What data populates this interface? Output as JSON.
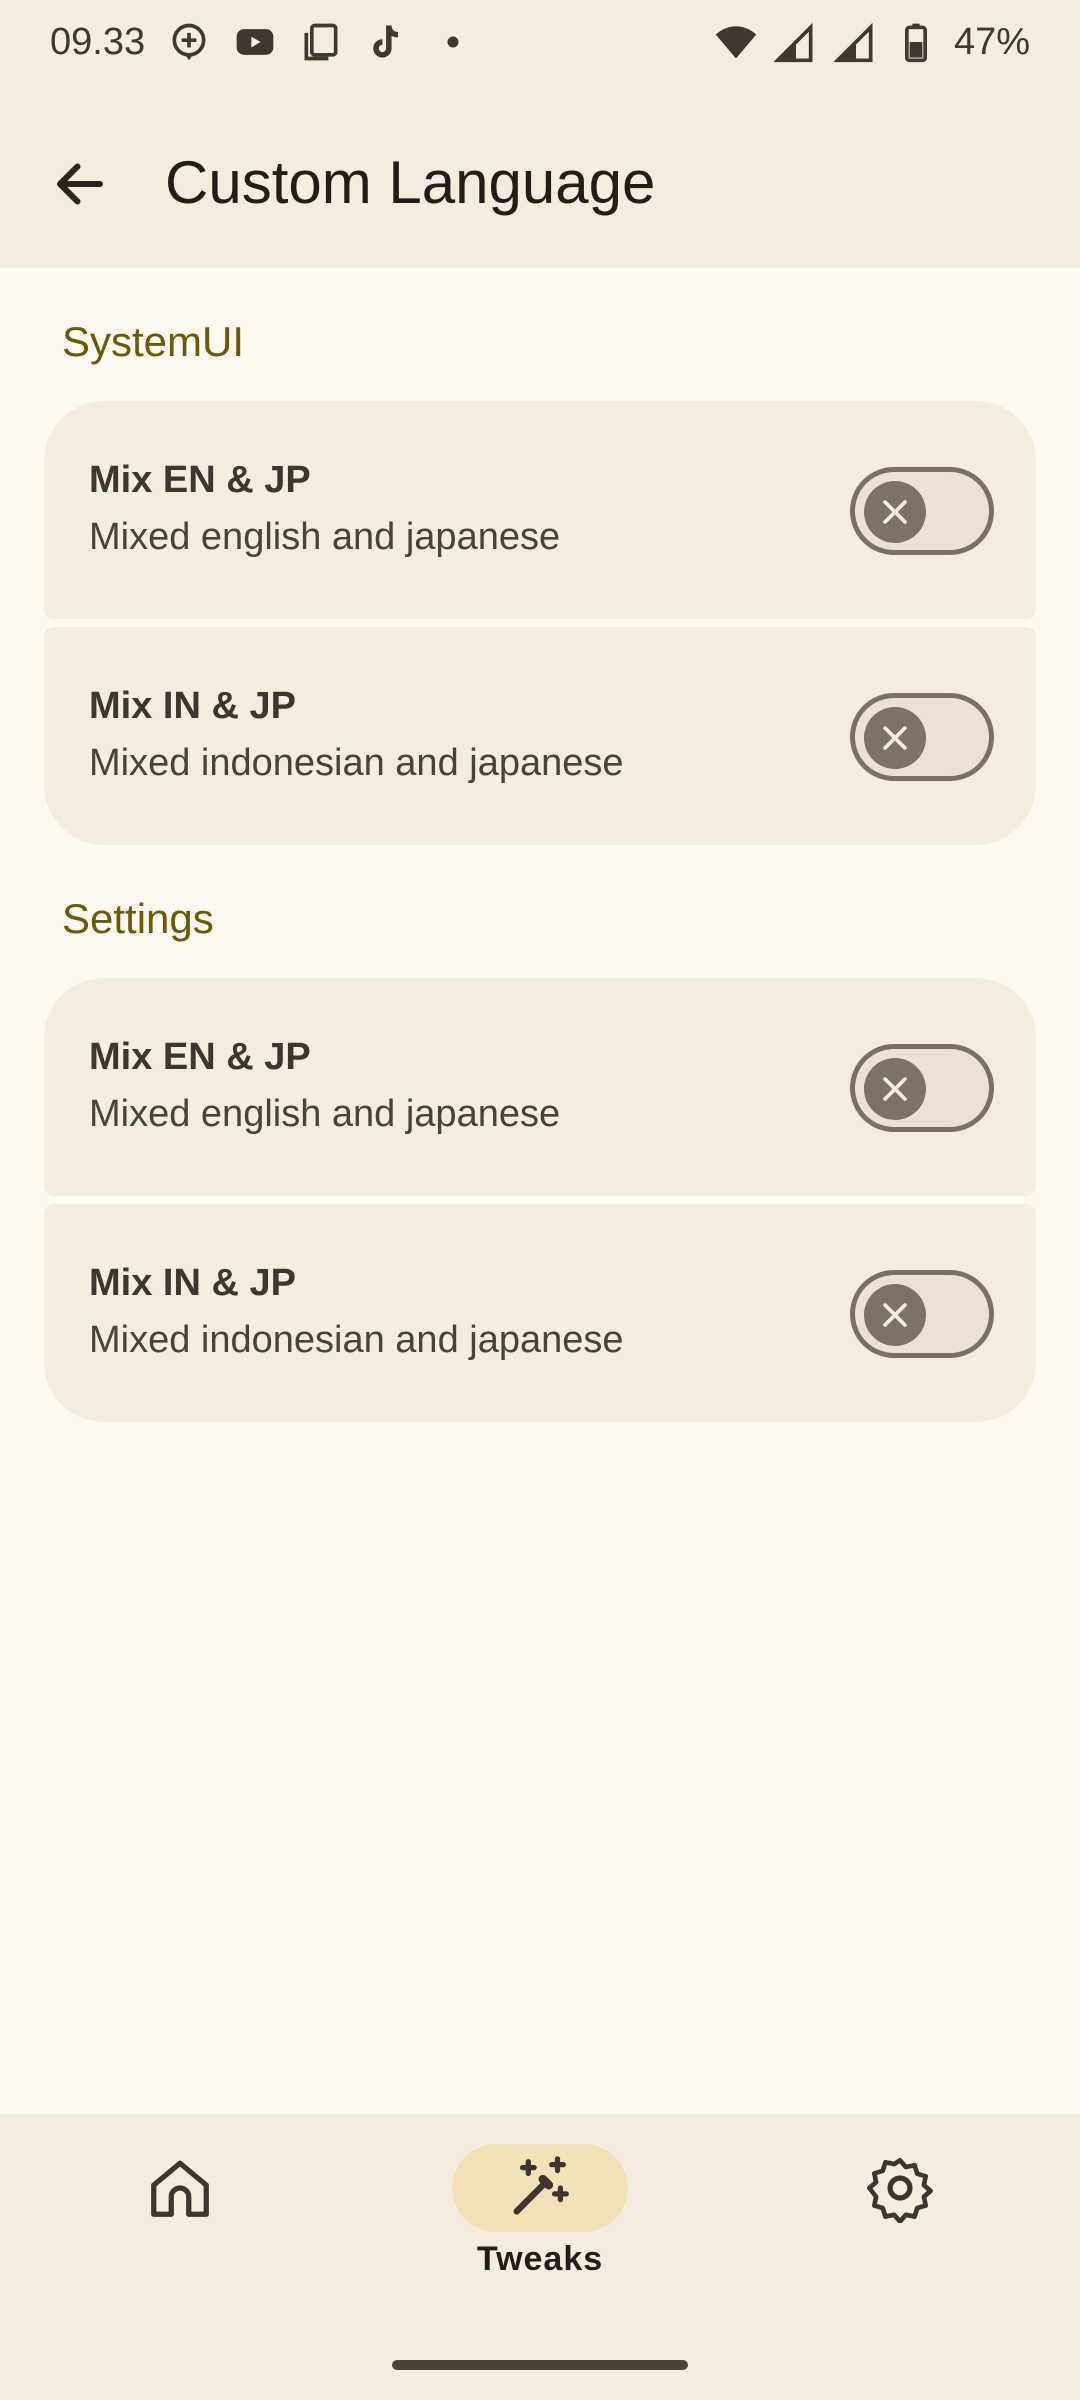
{
  "status_bar": {
    "time": "09.33",
    "battery": "47%",
    "icons_left": [
      "add-circle-icon",
      "youtube-icon",
      "copy-icon",
      "tiktok-icon",
      "dot-icon"
    ],
    "icons_right": [
      "wifi-icon",
      "signal-icon",
      "signal-icon",
      "battery-icon"
    ]
  },
  "app_bar": {
    "title": "Custom Language",
    "back_icon": "arrow-back-icon"
  },
  "sections": [
    {
      "title": "SystemUI",
      "items": [
        {
          "title": "Mix EN & JP",
          "subtitle": "Mixed english and japanese",
          "enabled": false
        },
        {
          "title": "Mix IN & JP",
          "subtitle": "Mixed indonesian and japanese",
          "enabled": false
        }
      ]
    },
    {
      "title": "Settings",
      "items": [
        {
          "title": "Mix EN & JP",
          "subtitle": "Mixed english and japanese",
          "enabled": false
        },
        {
          "title": "Mix IN & JP",
          "subtitle": "Mixed indonesian and japanese",
          "enabled": false
        }
      ]
    }
  ],
  "bottom_nav": {
    "items": [
      {
        "icon": "home-icon",
        "label": ""
      },
      {
        "icon": "magic-wand-icon",
        "label": "Tweaks",
        "active": true
      },
      {
        "icon": "gear-icon",
        "label": ""
      }
    ]
  },
  "colors": {
    "background": "#fff7f0",
    "surface": "#f5ece0",
    "section_title": "#6a5a06",
    "active_pill": "#f3e1b8",
    "toggle_off": "#7c7366"
  }
}
